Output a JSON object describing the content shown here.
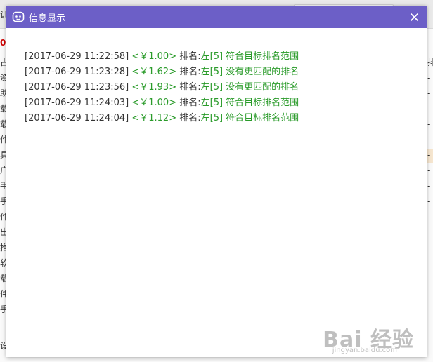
{
  "dialog": {
    "title": "信息显示",
    "close_symbol": "✕",
    "icon": "robot-icon",
    "accent_color": "#6c5fc7",
    "logs": [
      {
        "time": "[2017-06-29 11:22:58]",
        "price": "<￥1.00>",
        "rank_label": "排名:",
        "result": "左[5] 符合目标排名范围"
      },
      {
        "time": "[2017-06-29 11:23:28]",
        "price": "<￥1.62>",
        "rank_label": "排名:",
        "result": "左[5] 没有更匹配的排名"
      },
      {
        "time": "[2017-06-29 11:23:56]",
        "price": "<￥1.93>",
        "rank_label": "排名:",
        "result": "左[5] 没有更匹配的排名"
      },
      {
        "time": "[2017-06-29 11:24:03]",
        "price": "<￥1.00>",
        "rank_label": "排名:",
        "result": "左[5] 符合目标排名范围"
      },
      {
        "time": "[2017-06-29 11:24:04]",
        "price": "<￥1.12>",
        "rank_label": "排名:",
        "result": "左[5] 符合目标排名范围"
      }
    ]
  },
  "background": {
    "left_chars": [
      "训",
      "0",
      "古",
      "资",
      "助",
      "载",
      "载",
      "件",
      "具",
      "广",
      "手",
      "手",
      "件",
      "出",
      "推",
      "软",
      "载",
      "件",
      "手",
      "设"
    ],
    "right_chars": [
      "排",
      "-",
      "-",
      "-",
      "-",
      "-",
      "-",
      "-",
      "-",
      "-",
      "-"
    ]
  },
  "watermark": {
    "text": "Bai 经验",
    "sub": "jingyan.baidu.com"
  }
}
